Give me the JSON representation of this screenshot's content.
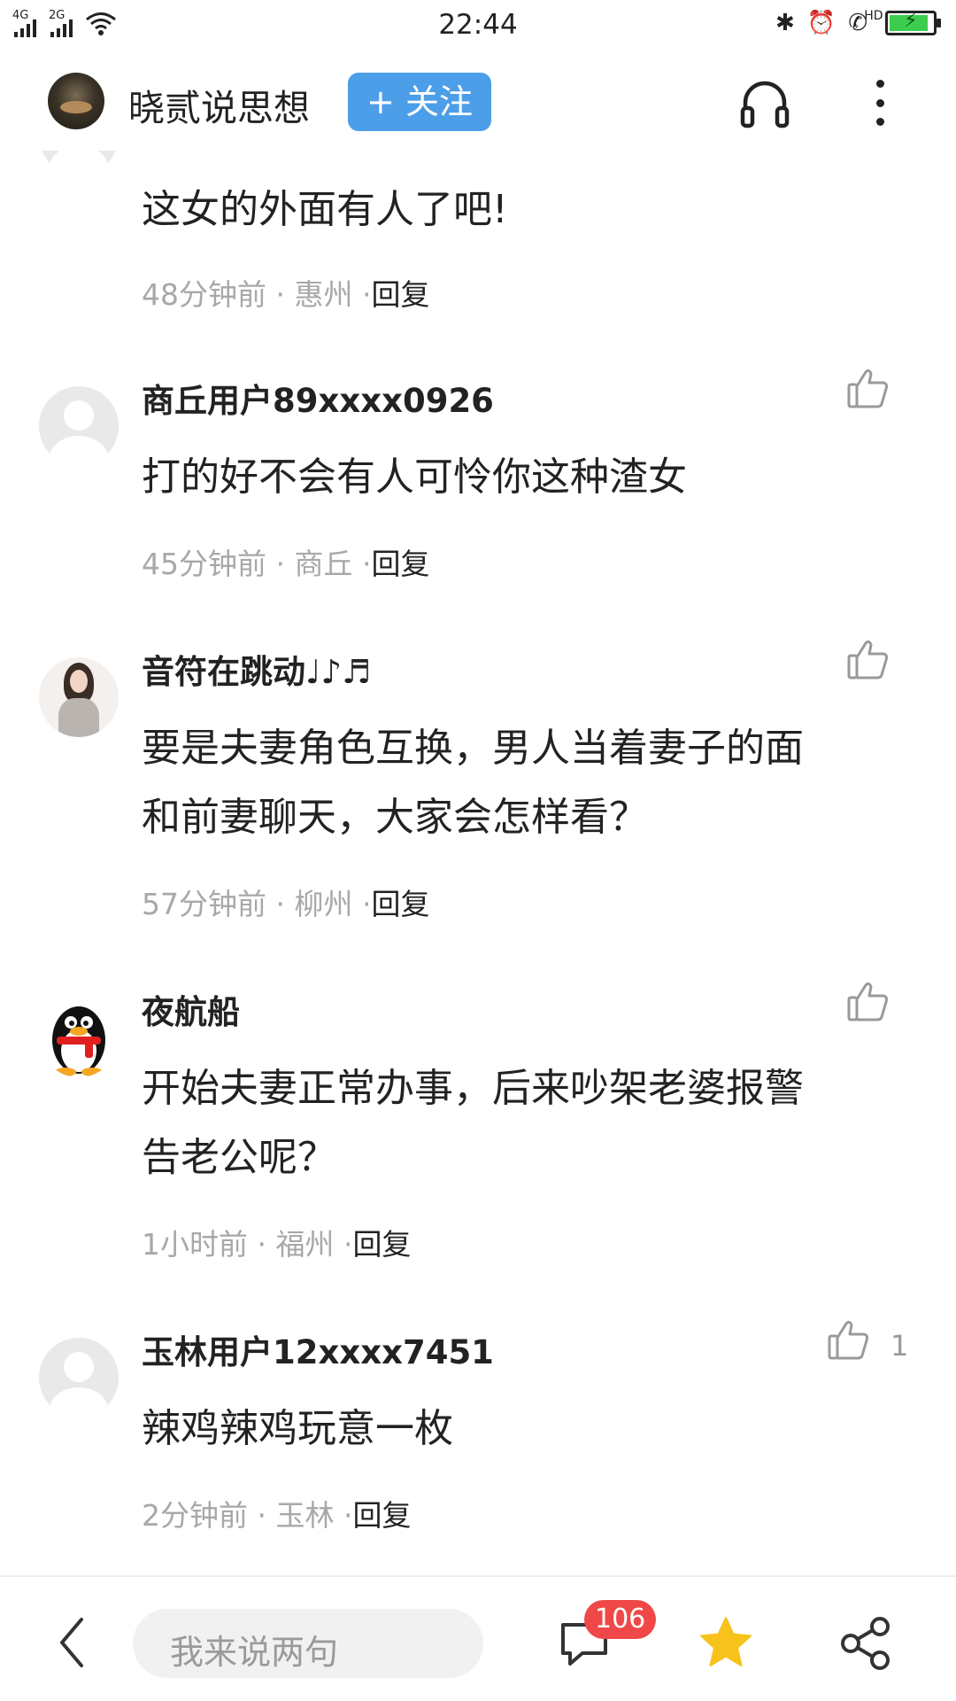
{
  "status_bar": {
    "signal_1_label": "4G",
    "signal_2_label": "2G",
    "time": "22:44",
    "bluetooth_glyph": "✱",
    "alarm_glyph": "⏰",
    "hd_label": "HD",
    "battery_level_percent": 90,
    "charging_glyph": "⚡"
  },
  "header": {
    "author_name": "晓贰说思想",
    "follow_label": "+ 关注"
  },
  "comments": [
    {
      "text": "这女的外面有人了吧!",
      "time": "48分钟前",
      "location": "惠州",
      "sep": "·",
      "reply": "回复"
    },
    {
      "name": "商丘用户89xxxx0926",
      "text": "打的好不会有人可怜你这种渣女",
      "time": "45分钟前",
      "location": "商丘",
      "sep": "·",
      "reply": "回复"
    },
    {
      "name": "音符在跳动♩♪♬",
      "text_line1": "要是夫妻角色互换，男人当着妻子的面",
      "text_line2": "和前妻聊天，大家会怎样看？",
      "time": "57分钟前",
      "location": "柳州",
      "sep": "·",
      "reply": "回复"
    },
    {
      "name": "夜航船",
      "text_line1": "开始夫妻正常办事，后来吵架老婆报警",
      "text_line2": "告老公呢？",
      "time": "1小时前",
      "location": "福州",
      "sep": "·",
      "reply": "回复"
    },
    {
      "name": "玉林用户12xxxx7451",
      "text": "辣鸡辣鸡玩意一枚",
      "time": "2分钟前",
      "location": "玉林",
      "sep": "·",
      "reply": "回复",
      "likes": "1"
    }
  ],
  "bottom_bar": {
    "input_placeholder": "我来说两句",
    "comment_count": "106"
  },
  "colors": {
    "follow_button": "#4d9ee8",
    "badge": "#f04848",
    "star": "#f7c21b",
    "meta_text": "#a8a8a8",
    "battery_fill": "#3ccd4e"
  },
  "icons": [
    "signal-icon",
    "wifi-icon",
    "bluetooth-icon",
    "alarm-icon",
    "hd-call-icon",
    "battery-icon",
    "headphone-icon",
    "more-icon",
    "thumbs-up-icon",
    "back-icon",
    "comment-icon",
    "star-icon",
    "share-icon"
  ]
}
